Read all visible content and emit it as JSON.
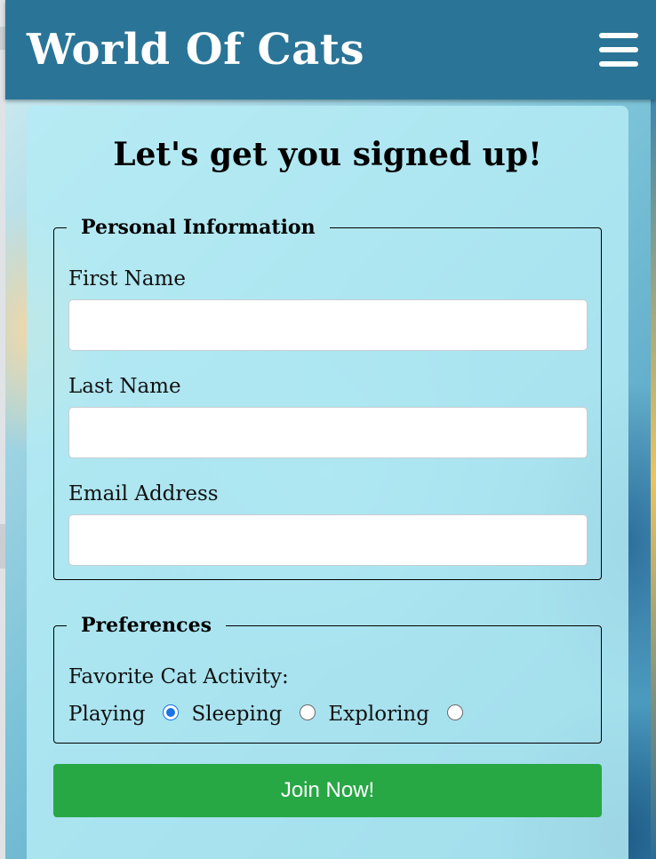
{
  "navbar": {
    "brand": "World Of Cats",
    "menu_icon": "hamburger-menu-icon"
  },
  "form": {
    "title": "Let's get you signed up!",
    "personal": {
      "legend": "Personal Information",
      "first_name_label": "First Name",
      "first_name_value": "",
      "last_name_label": "Last Name",
      "last_name_value": "",
      "email_label": "Email Address",
      "email_value": ""
    },
    "preferences": {
      "legend": "Preferences",
      "question": "Favorite Cat Activity:",
      "options": [
        {
          "label": "Playing",
          "checked": true
        },
        {
          "label": "Sleeping",
          "checked": false
        },
        {
          "label": "Exploring",
          "checked": false
        }
      ]
    },
    "submit_label": "Join Now!"
  },
  "colors": {
    "navbar": "#2a7597",
    "card": "#b4ebf5",
    "submit": "#28a745",
    "radio_checked": "#1a73e8"
  }
}
